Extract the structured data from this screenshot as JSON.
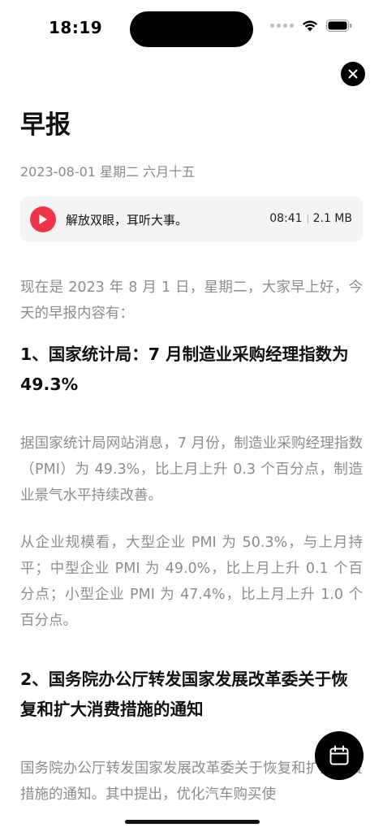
{
  "status_bar": {
    "time": "18:19"
  },
  "header": {
    "close_icon": "close-icon",
    "title": "早报",
    "date": "2023-08-01 星期二 六月十五"
  },
  "audio": {
    "play_icon": "play-icon",
    "accent_color": "#f0344a",
    "title": "解放双眼，耳听大事。",
    "duration": "08:41",
    "size": "2.1 MB"
  },
  "article": {
    "intro": "现在是 2023 年 8 月 1 日，星期二，大家早上好，今天的早报内容有：",
    "sections": [
      {
        "heading": "1、国家统计局：7 月制造业采购经理指数为 49.3%",
        "paragraphs": [
          "据国家统计局网站消息，7 月份，制造业采购经理指数（PMI）为 49.3%，比上月上升 0.3 个百分点，制造业景气水平持续改善。",
          "从企业规模看，大型企业 PMI 为 50.3%，与上月持平；中型企业 PMI 为 49.0%，比上月上升 0.1 个百分点；小型企业 PMI 为 47.4%，比上月上升 1.0 个百分点。"
        ]
      },
      {
        "heading": "2、国务院办公厅转发国家发展改革委关于恢复和扩大消费措施的通知",
        "paragraphs": [
          "国务院办公厅转发国家发展改革委关于恢复和扩大消费措施的通知。其中提出，优化汽车购买使"
        ]
      }
    ]
  },
  "fab": {
    "icon": "calendar-icon"
  }
}
